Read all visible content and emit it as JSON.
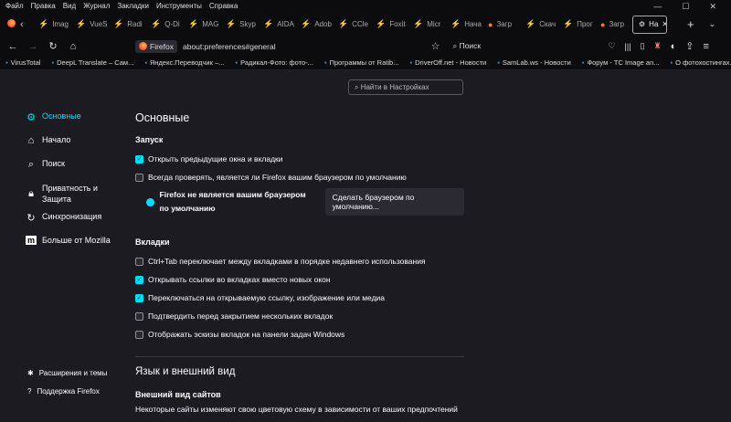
{
  "menu": [
    "Файл",
    "Правка",
    "Вид",
    "Журнал",
    "Закладки",
    "Инструменты",
    "Справка"
  ],
  "window_controls": [
    "—",
    "☐",
    "✕"
  ],
  "tabs": [
    "Imag",
    "VueS",
    "Radi",
    "Q-Di",
    "MAG",
    "Skyp",
    "AIDA",
    "Adob",
    "CCle",
    "Foxit",
    "Micr",
    "Нача",
    "Загр",
    "Скач",
    "Прог",
    "Загр"
  ],
  "active_tab": "На",
  "nav": {
    "chip": "Firefox",
    "url": "about:preferences#general",
    "search": "Поиск"
  },
  "bookmarks": [
    "VirusTotal",
    "DeepL Translate – Сам...",
    "Яндекс.Переводчик –...",
    "Радикал-Фото: фото-...",
    "Программы от Ratib...",
    "DriverOff.net - Новости",
    "SamLab.ws - Новости",
    "Форум - TC Image an...",
    "О фотохостингах. Вн..."
  ],
  "search_placeholder": "Найти в Настройках",
  "sidebar": [
    "Основные",
    "Начало",
    "Поиск",
    "Приватность и Защита",
    "Синхронизация",
    "Больше от Mozilla"
  ],
  "sidebar_bottom": [
    "Расширения и темы",
    "Поддержка Firefox"
  ],
  "main": {
    "title": "Основные",
    "startup": "Запуск",
    "startup_opts": [
      {
        "label": "Открыть предыдущие окна и вкладки",
        "checked": true
      },
      {
        "label": "Всегда проверять, является ли Firefox вашим браузером по умолчанию",
        "checked": false
      }
    ],
    "not_default": "Firefox не является вашим браузером по умолчанию",
    "make_default": "Сделать браузером по умолчанию...",
    "tabs_title": "Вкладки",
    "tabs_opts": [
      {
        "label": "Ctrl+Tab переключает между вкладками в порядке недавнего использования",
        "checked": false
      },
      {
        "label": "Открывать ссылки во вкладках вместо новых окон",
        "checked": true
      },
      {
        "label": "Переключаться на открываемую ссылку, изображение или медиа",
        "checked": true
      },
      {
        "label": "Подтвердить перед закрытием нескольких вкладок",
        "checked": false
      },
      {
        "label": "Отображать эскизы вкладок на панели задач Windows",
        "checked": false
      }
    ],
    "lang_title": "Язык и внешний вид",
    "sites_title": "Внешний вид сайтов",
    "sites_desc": "Некоторые сайты изменяют свою цветовую схему в зависимости от ваших предпочтений"
  }
}
